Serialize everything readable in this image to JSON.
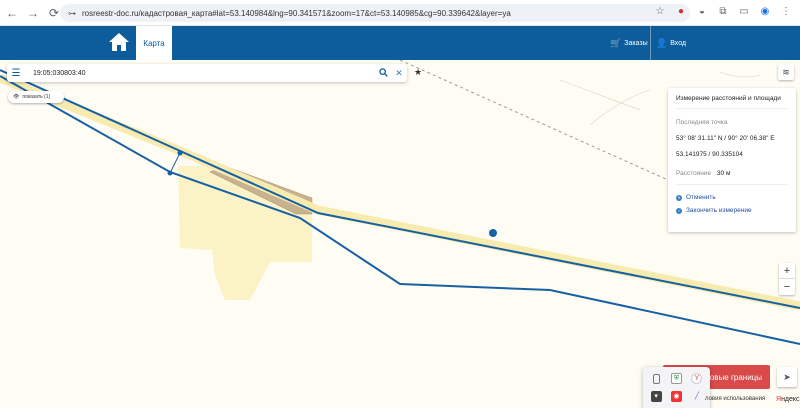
{
  "browser": {
    "url": "rosreestr-doc.ru/кадастровая_карта#lat=53.140984&lng=90.341571&zoom=17&ct=53.140985&cg=90.339642&layer=ya"
  },
  "header": {
    "tab_map": "Карта",
    "orders": "Заказы",
    "login": "Вход"
  },
  "search": {
    "query": "19:05:030803:40"
  },
  "show_chip": "показать (1)",
  "measure_panel": {
    "title": "Измерение расстояний и площади",
    "last_point_label": "Последняя точка",
    "coords_dms": "53° 08' 31.11\" N / 90° 20' 06.38\" E",
    "coords_dec": "53.141975 / 90.335104",
    "distance_label": "Расстояние",
    "distance_value": "30 м",
    "cancel": "Отменить",
    "finish": "Закончить измерение"
  },
  "zoom": {
    "plus": "+",
    "minus": "−"
  },
  "red_button": "говые границы",
  "footer": {
    "terms": "ловия использования",
    "yandex_red": "Я",
    "yandex_rest": "ндекс"
  },
  "colors": {
    "header_bg": "#0d5c9c",
    "map_bg": "#fffdf3",
    "parcel_fill": "#fbf2c6",
    "road_line": "#1660a4",
    "building": "#c8b28e",
    "red_button": "#d94a4a"
  }
}
